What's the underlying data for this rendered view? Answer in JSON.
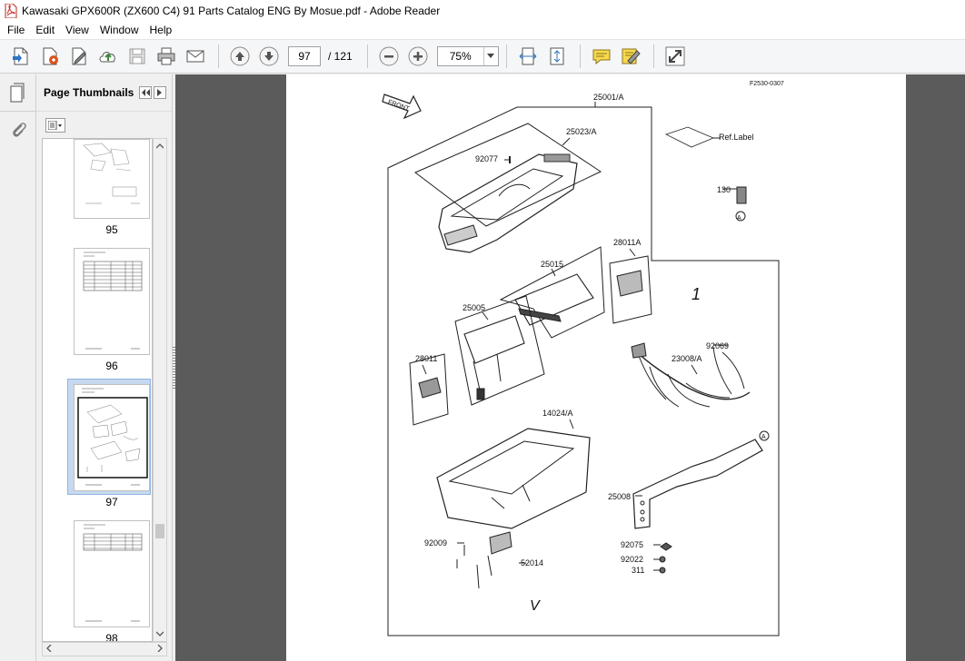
{
  "window": {
    "title": "Kawasaki GPX600R (ZX600 C4) 91 Parts Catalog ENG By Mosue.pdf - Adobe Reader"
  },
  "menu": {
    "items": [
      "File",
      "Edit",
      "View",
      "Window",
      "Help"
    ]
  },
  "toolbar": {
    "current_page": "97",
    "page_total": "/ 121",
    "zoom": "75%"
  },
  "thumbnails_panel": {
    "title": "Page Thumbnails",
    "pages": [
      {
        "label": "95",
        "selected": false
      },
      {
        "label": "96",
        "selected": false
      },
      {
        "label": "97",
        "selected": true
      },
      {
        "label": "98",
        "selected": false
      }
    ]
  },
  "document": {
    "figure_code": "F2530-0307",
    "front_arrow": "FRONT",
    "ref_label": "Ref.Label",
    "part_labels": {
      "p25001": "25001/A",
      "p25023": "25023/A",
      "p92077": "92077",
      "p130": "130",
      "p28011a": "28011A",
      "p25015": "25015",
      "p25005": "25005",
      "p28011": "28011",
      "p92069": "92069",
      "p23008": "23008/A",
      "p14024": "14024/A",
      "p25008": "25008",
      "p92009": "92009",
      "p52014": "52014",
      "p92075": "92075",
      "p92022": "92022",
      "p311": "311",
      "circleA": "A"
    },
    "marks": {
      "mark1": "1",
      "markV": "V"
    }
  }
}
